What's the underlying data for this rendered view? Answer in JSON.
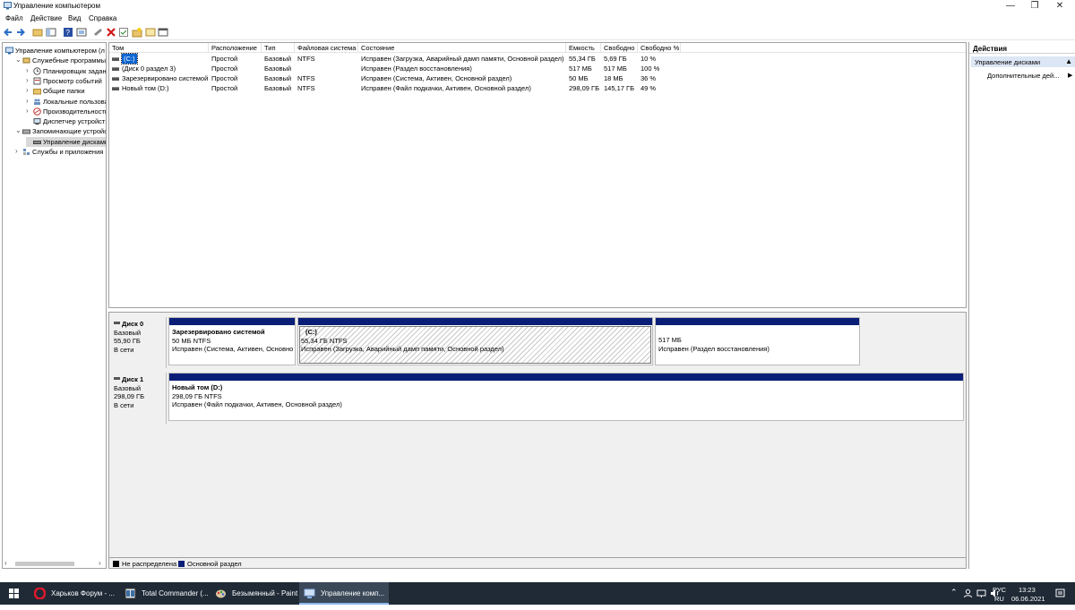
{
  "window": {
    "title": "Управление компьютером",
    "minimize": "—",
    "restore": "❐",
    "close": "✕"
  },
  "menu": [
    "Файл",
    "Действие",
    "Вид",
    "Справка"
  ],
  "tree": [
    {
      "label": "Управление компьютером (л",
      "arrow": "",
      "level": 0,
      "icon": "computer-icon"
    },
    {
      "label": "Служебные программы",
      "arrow": "⌄",
      "level": 1,
      "icon": "tools-icon"
    },
    {
      "label": "Планировщик заданий",
      "arrow": "›",
      "level": 2,
      "icon": "clock-icon"
    },
    {
      "label": "Просмотр событий",
      "arrow": "›",
      "level": 2,
      "icon": "event-icon"
    },
    {
      "label": "Общие папки",
      "arrow": "›",
      "level": 2,
      "icon": "folder-icon"
    },
    {
      "label": "Локальные пользовате",
      "arrow": "›",
      "level": 2,
      "icon": "users-icon"
    },
    {
      "label": "Производительность",
      "arrow": "›",
      "level": 2,
      "icon": "performance-icon"
    },
    {
      "label": "Диспетчер устройств",
      "arrow": "",
      "level": 2,
      "icon": "device-icon"
    },
    {
      "label": "Запоминающие устройст",
      "arrow": "⌄",
      "level": 1,
      "icon": "storage-icon"
    },
    {
      "label": "Управление дисками",
      "arrow": "",
      "level": 2,
      "icon": "disk-icon",
      "selected": true
    },
    {
      "label": "Службы и приложения",
      "arrow": "›",
      "level": 1,
      "icon": "services-icon"
    }
  ],
  "table": {
    "headers": [
      "Том",
      "Расположение",
      "Тип",
      "Файловая система",
      "Состояние",
      "Емкость",
      "Свободно",
      "Свободно %"
    ],
    "rows": [
      [
        "(C:)",
        "Простой",
        "Базовый",
        "NTFS",
        "Исправен (Загрузка, Аварийный дамп памяти, Основной раздел)",
        "55,34 ГБ",
        "5,69 ГБ",
        "10 %"
      ],
      [
        "(Диск 0 раздел 3)",
        "Простой",
        "Базовый",
        "",
        "Исправен (Раздел восстановления)",
        "517 МБ",
        "517 МБ",
        "100 %"
      ],
      [
        "Зарезервировано системой",
        "Простой",
        "Базовый",
        "NTFS",
        "Исправен (Система, Активен, Основной раздел)",
        "50 МБ",
        "18 МБ",
        "36 %"
      ],
      [
        "Новый том (D:)",
        "Простой",
        "Базовый",
        "NTFS",
        "Исправен (Файл подкачки, Активен, Основной раздел)",
        "298,09 ГБ",
        "145,17 ГБ",
        "49 %"
      ]
    ]
  },
  "disks": [
    {
      "name": "Диск 0",
      "type": "Базовый",
      "size": "55,90 ГБ",
      "status": "В сети",
      "partitions": [
        {
          "name": "Зарезервировано системой",
          "size": "50 МБ NTFS",
          "state": "Исправен (Система, Активен, Основно"
        },
        {
          "name": "(C:)",
          "size": "55,34 ГБ NTFS",
          "state": "Исправен (Загрузка, Аварийный дамп памяти, Основной раздел)"
        },
        {
          "name": "",
          "size": "517 МБ",
          "state": "Исправен (Раздел восстановления)"
        }
      ]
    },
    {
      "name": "Диск 1",
      "type": "Базовый",
      "size": "298,09 ГБ",
      "status": "В сети",
      "partitions": [
        {
          "name": "Новый том  (D:)",
          "size": "298,09 ГБ NTFS",
          "state": "Исправен (Файл подкачки, Активен, Основной раздел)"
        }
      ]
    }
  ],
  "legend": [
    {
      "label": "Не распределена",
      "color": "#000000"
    },
    {
      "label": "Основной раздел",
      "color": "#0a1e78"
    }
  ],
  "actions": {
    "header": "Действия",
    "section": "Управление дисками",
    "item": "Дополнительные дей..."
  },
  "taskbar": {
    "apps": [
      {
        "label": "Харьков Форум - ...",
        "icon": "opera-icon"
      },
      {
        "label": "Total Commander (...",
        "icon": "total-commander-icon"
      },
      {
        "label": "Безымянный - Paint",
        "icon": "paint-icon"
      },
      {
        "label": "Управление комп...",
        "icon": "computer-management-icon",
        "active": true
      }
    ],
    "lang_top": "РУС",
    "lang_bottom": "RU",
    "time": "13:23",
    "date": "06.06.2021"
  }
}
